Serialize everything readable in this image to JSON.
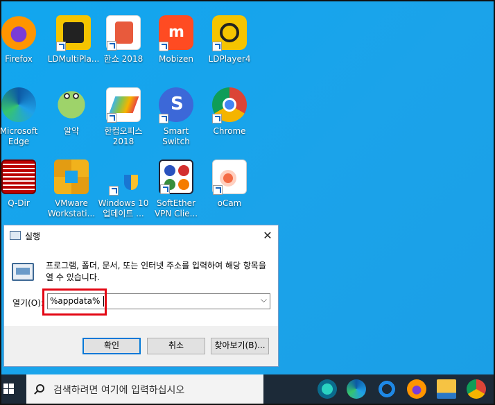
{
  "desktop": {
    "icons": [
      {
        "label": "Firefox"
      },
      {
        "label": "LDMultiPla..."
      },
      {
        "label": "한쇼 2018"
      },
      {
        "label": "Mobizen"
      },
      {
        "label": "LDPlayer4"
      },
      {
        "label": "Microsoft\nEdge"
      },
      {
        "label": "알약"
      },
      {
        "label": "한컴오피스\n2018"
      },
      {
        "label": "Smart Switch"
      },
      {
        "label": "Chrome"
      },
      {
        "label": "Q-Dir"
      },
      {
        "label": "VMware\nWorkstati..."
      },
      {
        "label": "Windows 10\n업데이트 ..."
      },
      {
        "label": "SoftEther\nVPN Clie..."
      },
      {
        "label": "oCam"
      }
    ]
  },
  "run_dialog": {
    "title": "실행",
    "close": "✕",
    "description": "프로그램, 폴더, 문서, 또는 인터넷 주소를 입력하여 해당 항목을 열 수 있습니다.",
    "open_label": "열기(O):",
    "open_value": "%appdata%",
    "dropdown": "⌵",
    "ok": "확인",
    "cancel": "취소",
    "browse": "찾아보기(B)..."
  },
  "taskbar": {
    "search_placeholder": "검색하려면 여기에 입력하십시오"
  },
  "colors": {
    "desktop": "#1aa3ec",
    "taskbar": "#1c2a38",
    "highlight": "#e30613"
  }
}
